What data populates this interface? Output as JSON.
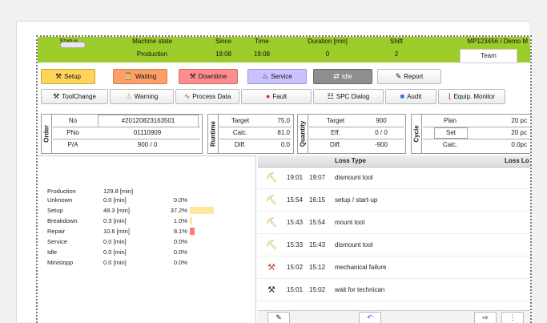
{
  "header": {
    "labels": {
      "status": "Status",
      "machine_state": "Machine state",
      "since": "Since",
      "time": "Time",
      "duration": "Duration [min]",
      "shift": "Shift",
      "machine_id": "MP123456 / Demo M"
    },
    "values": {
      "machine_state": "Production",
      "since": "19:08",
      "time": "19:08",
      "duration": "0",
      "shift": "2"
    },
    "team_label": "Team",
    "accent_color": "#9ccc2a"
  },
  "buttons_row1": {
    "setup": "Setup",
    "waiting": "Waiting",
    "downtime": "Downtime",
    "service": "Service",
    "idle": "Idle",
    "report": "Report"
  },
  "buttons_row2": {
    "toolchange": "ToolChange",
    "warning": "Warning",
    "process_data": "Process Data",
    "fault": "Fault",
    "spc_dialog": "SPC Dialog",
    "audit": "Audit",
    "equip_monitor": "Equip. Monitor"
  },
  "order": {
    "title": "Order",
    "no_label": "No",
    "no_value": "#20120823163501",
    "pno_label": "PNo",
    "pno_value": "01110909",
    "pa_label": "P/A",
    "pa_value": "900 / 0"
  },
  "runtime": {
    "title": "Runtime",
    "target_label": "Target",
    "target_value": "75.0",
    "calc_label": "Calc.",
    "calc_value": "81.0",
    "diff_label": "Diff.",
    "diff_value": "0.0"
  },
  "quantity": {
    "title": "Quantity",
    "target_label": "Target",
    "target_value": "900",
    "eff_label": "Eff.",
    "eff_value": "0 / 0",
    "diff_label": "Diff.",
    "diff_value": "-900"
  },
  "cycle": {
    "title": "Cycle",
    "plan_label": "Plan",
    "plan_value": "20 pc",
    "set_label": "Set",
    "set_value": "20 pc",
    "calc_label": "Calc.",
    "calc_value": "0.0pc"
  },
  "stats": [
    {
      "label": "Production",
      "value": "129.8 [min]",
      "pct": "",
      "bar": 0,
      "color": ""
    },
    {
      "label": "Unknown",
      "value": "0.0 [min]",
      "pct": "0.0%",
      "bar": 0,
      "color": ""
    },
    {
      "label": "Setup",
      "value": "48.3 [min]",
      "pct": "37.2%",
      "bar": 37.2,
      "color": "#ffe6a0"
    },
    {
      "label": "Breakdown",
      "value": "0.3 [min]",
      "pct": "1.0%",
      "bar": 1.0,
      "color": "#ffe6a0"
    },
    {
      "label": "Repair",
      "value": "10.6 [min]",
      "pct": "8.1%",
      "bar": 8.1,
      "color": "#ff7a7a"
    },
    {
      "label": "Service",
      "value": "0.0 [min]",
      "pct": "0.0%",
      "bar": 0,
      "color": ""
    },
    {
      "label": "Idle",
      "value": "0.0 [min]",
      "pct": "0.0%",
      "bar": 0,
      "color": ""
    },
    {
      "label": "Ministopp",
      "value": "0.0 [min]",
      "pct": "0.0%",
      "bar": 0,
      "color": ""
    }
  ],
  "loss": {
    "head_type": "Loss Type",
    "head_lo": "Loss Lo",
    "rows": [
      {
        "icon": "setup-icon",
        "start": "19:01",
        "end": "19:07",
        "text": "dismount tool"
      },
      {
        "icon": "setup-icon",
        "start": "15:54",
        "end": "16:15",
        "text": "setup / start-up"
      },
      {
        "icon": "setup-icon",
        "start": "15:43",
        "end": "15:54",
        "text": "mount tool"
      },
      {
        "icon": "setup-icon",
        "start": "15:33",
        "end": "15:43",
        "text": "dismount tool"
      },
      {
        "icon": "tools-icon",
        "start": "15:02",
        "end": "15:12",
        "text": "mechanical failure"
      },
      {
        "icon": "wrench-icon",
        "start": "15:01",
        "end": "15:02",
        "text": "wait for technican"
      }
    ]
  }
}
